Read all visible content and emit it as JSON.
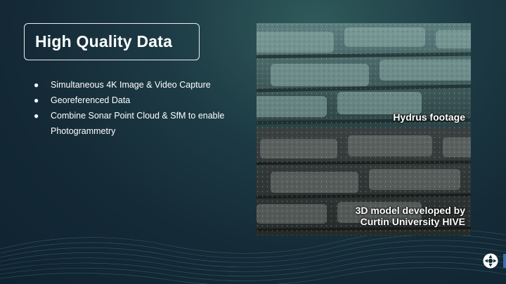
{
  "slide": {
    "title": "High Quality Data",
    "bullets": [
      "Simultaneous 4K Image & Video Capture",
      "Georeferenced Data",
      "Combine Sonar Point Cloud & SfM to enable Photogrammetry"
    ]
  },
  "photo": {
    "caption_top": "Hydrus footage",
    "caption_bottom_line1": "3D model developed by",
    "caption_bottom_line2": "Curtin University HIVE"
  },
  "icons": {
    "bullet": "bullet-dot",
    "logo": "company-logo-icon"
  },
  "colors": {
    "background": "#142a36",
    "accent_tab": "#3a6ea8",
    "title_border": "#e8eef0"
  }
}
